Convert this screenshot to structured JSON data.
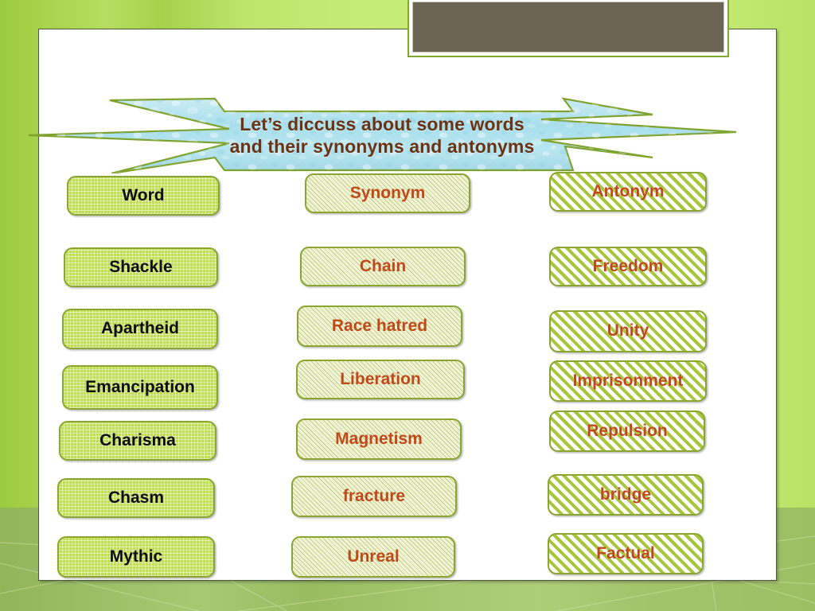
{
  "slide": {
    "banner": {
      "line1": "Let’s diccuss about some words",
      "line2": "and their synonyms and antonyms"
    },
    "top_frame": {
      "name": "empty-picture-placeholder",
      "fill_color": "#6d6554"
    }
  },
  "colors": {
    "box_border": "#8aa630",
    "word_text": "#0d0d0d",
    "accent_text": "#c0491c",
    "banner_text": "#6b3214",
    "banner_fill": "#ace0ec",
    "banner_border": "#7fa32e",
    "background_green": "#bde46c",
    "footer_green": "#a2c36a",
    "card_bg": "#ffffff"
  },
  "table": {
    "headers": [
      {
        "label": "Word",
        "column": "word"
      },
      {
        "label": "Synonym",
        "column": "synonym"
      },
      {
        "label": "Antonym",
        "column": "antonym"
      }
    ],
    "rows": [
      {
        "word": "Shackle",
        "synonym": "Chain",
        "antonym": "Freedom"
      },
      {
        "word": "Apartheid",
        "synonym": "Race hatred",
        "antonym": "Unity"
      },
      {
        "word": "Emancipation",
        "synonym": "Liberation",
        "antonym": "Imprisonment"
      },
      {
        "word": "Charisma",
        "synonym": "Magnetism",
        "antonym": "Repulsion"
      },
      {
        "word": "Chasm",
        "synonym": "fracture",
        "antonym": "bridge"
      },
      {
        "word": "Mythic",
        "synonym": "Unreal",
        "antonym": "Factual"
      }
    ]
  }
}
